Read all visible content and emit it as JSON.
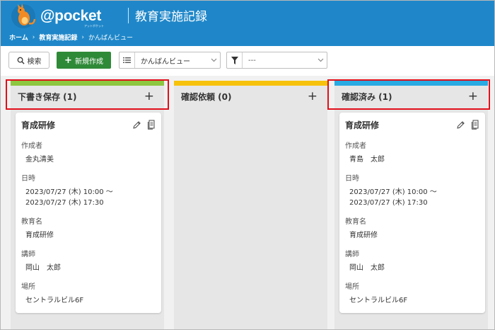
{
  "header": {
    "logo_text": "@pocket",
    "logo_sub": "アットポケット",
    "app_title": "教育実施記録",
    "breadcrumb": {
      "home": "ホーム",
      "sep1": "›",
      "section": "教育実施記録",
      "sep2": "›",
      "current": "かんばんビュー"
    }
  },
  "toolbar": {
    "search_label": "検索",
    "new_label": "新規作成",
    "view_value": "かんばんビュー",
    "filter_value": "---"
  },
  "colors": {
    "header_bg": "#1f87c9",
    "draft": "#8dc63f",
    "pending": "#f7c20c",
    "confirmed": "#29aae2",
    "highlight": "#e10f1a"
  },
  "labels": {
    "author": "作成者",
    "datetime": "日時",
    "course": "教育名",
    "lecturer": "講師",
    "place": "場所"
  },
  "columns": [
    {
      "title": "下書き保存 (1)",
      "add": "+",
      "card": {
        "title": "育成研修",
        "author": "金丸清美",
        "datetime_1": "2023/07/27 (木) 10:00 ～",
        "datetime_2": "2023/07/27 (木) 17:30",
        "course": "育成研修",
        "lecturer": "岡山　太郎",
        "place": "セントラルビル6F"
      }
    },
    {
      "title": "確認依頼 (0)",
      "add": "+"
    },
    {
      "title": "確認済み (1)",
      "add": "+",
      "card": {
        "title": "育成研修",
        "author": "青島　太郎",
        "datetime_1": "2023/07/27 (木) 10:00 ～",
        "datetime_2": "2023/07/27 (木) 17:30",
        "course": "育成研修",
        "lecturer": "岡山　太郎",
        "place": "セントラルビル6F"
      }
    }
  ]
}
